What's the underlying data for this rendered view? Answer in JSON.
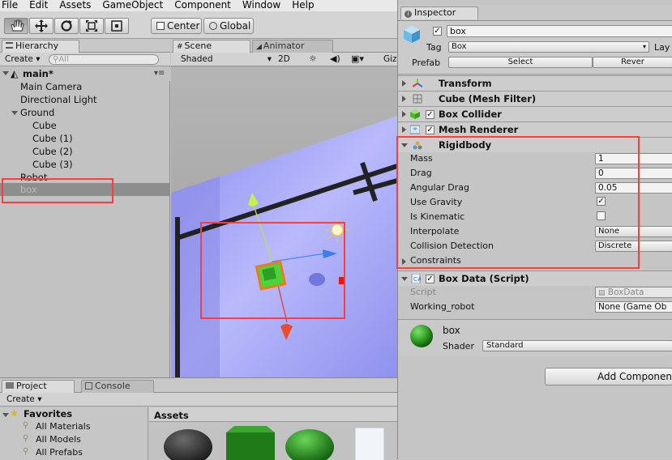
{
  "menubar": [
    "File",
    "Edit",
    "Assets",
    "GameObject",
    "Component",
    "Window",
    "Help"
  ],
  "toolbar": {
    "pivot_label": "Center",
    "space_label": "Global"
  },
  "hierarchy": {
    "tab": "Hierarchy",
    "create_label": "Create",
    "search_placeholder": "All",
    "scene_name": "main*",
    "items": [
      "Main Camera",
      "Directional Light",
      "Ground",
      "Cube",
      "Cube (1)",
      "Cube (2)",
      "Cube (3)",
      "Robot",
      "box"
    ]
  },
  "scene": {
    "tab": "Scene",
    "tab2": "Animator",
    "shading": "Shaded",
    "mode_2d": "2D",
    "gizmos": "Giz"
  },
  "inspector": {
    "tab": "Inspector",
    "object_name": "box",
    "tag_label": "Tag",
    "tag_value": "Box",
    "layer_label": "Lay",
    "prefab_label": "Prefab",
    "select_label": "Select",
    "revert_label": "Rever",
    "components": [
      "Transform",
      "Cube (Mesh Filter)",
      "Box Collider",
      "Mesh Renderer",
      "Rigidbody"
    ],
    "rigidbody": {
      "mass_label": "Mass",
      "mass": "1",
      "drag_label": "Drag",
      "drag": "0",
      "angular_drag_label": "Angular Drag",
      "angular_drag": "0.05",
      "use_gravity_label": "Use Gravity",
      "is_kinematic_label": "Is Kinematic",
      "interpolate_label": "Interpolate",
      "interpolate": "None",
      "collision_label": "Collision Detection",
      "collision": "Discrete",
      "constraints_label": "Constraints"
    },
    "script_component": {
      "title": "Box Data (Script)",
      "script_label": "Script",
      "script_value": "BoxData",
      "robot_label": "Working_robot",
      "robot_value": "None (Game Ob"
    },
    "material": {
      "name": "box",
      "shader_label": "Shader",
      "shader_value": "Standard"
    },
    "add_component": "Add Componen"
  },
  "project": {
    "tab": "Project",
    "tab2": "Console",
    "create_label": "Create",
    "favorites_label": "Favorites",
    "favorites": [
      "All Materials",
      "All Models",
      "All Prefabs"
    ],
    "assets_label": "Assets"
  }
}
